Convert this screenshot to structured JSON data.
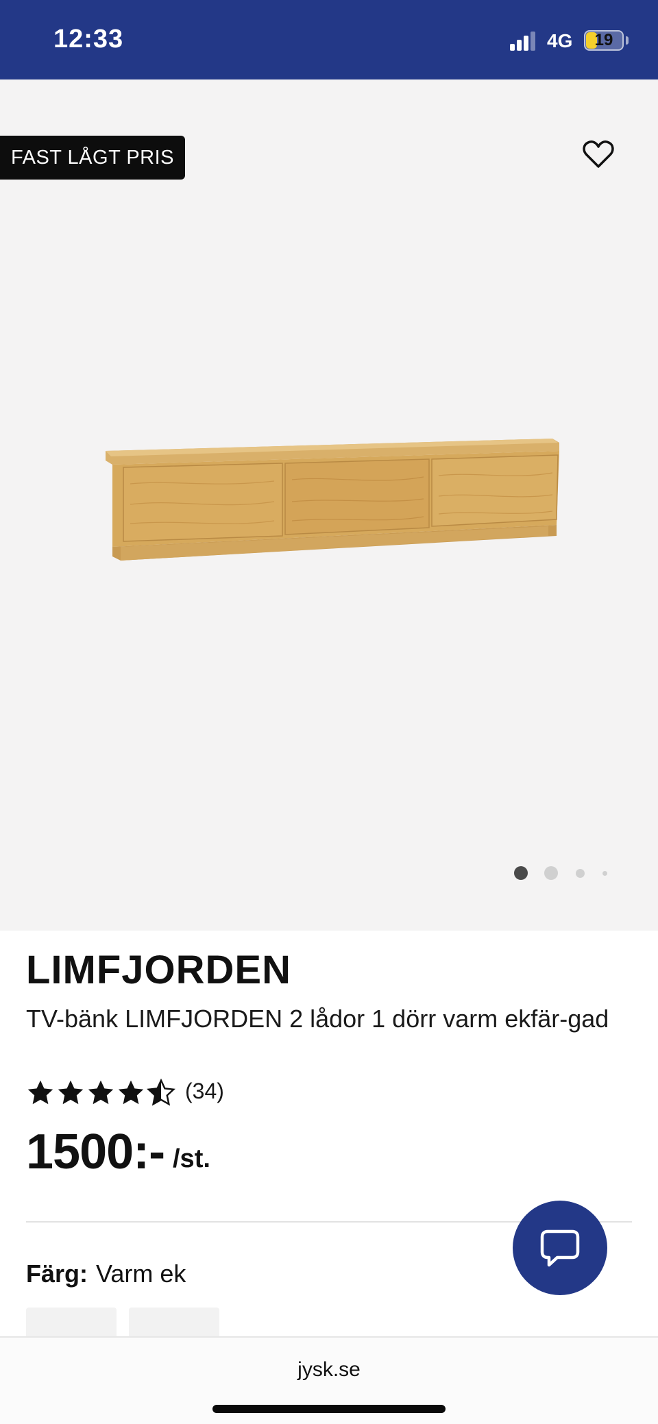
{
  "status_bar": {
    "time": "12:33",
    "network": "4G",
    "battery": "19",
    "battery_level": 0.19,
    "background_color": "#233887"
  },
  "product_image": {
    "badge": "FAST LÅGT PRIS",
    "favorite_icon": "heart-outline-icon",
    "carousel_total": 4,
    "carousel_active": 1
  },
  "product": {
    "brand": "LIMFJORDEN",
    "description": "TV-bänk LIMFJORDEN 2 lådor 1 dörr varm ekfär-gad",
    "rating": 4.5,
    "rating_max": 5,
    "rating_count": "(34)",
    "price": "1500:-",
    "unit": "/st.",
    "color_label": "Färg:",
    "color_value": "Varm ek"
  },
  "chat": {
    "icon": "chat-bubble-icon",
    "color": "#233887"
  },
  "browser": {
    "url": "jysk.se"
  }
}
